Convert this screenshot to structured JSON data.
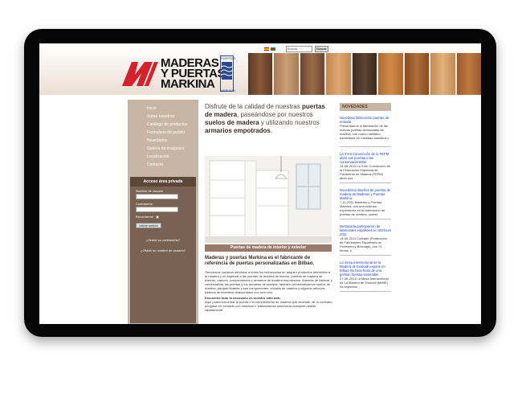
{
  "header": {
    "brand_lines": [
      "Maderas",
      "y puertas",
      "Markina"
    ],
    "puertas_label": "PUERTAS",
    "nervion_label": "NERVION",
    "search_placeholder": "Buscar ...",
    "search_button": "Buscar"
  },
  "nav": {
    "items": [
      "Inicio",
      "Sobre nosotros",
      "Catálogo de productos",
      "Formulario de pedido",
      "Novedades",
      "Galería de imágenes",
      "Localización",
      "Contacto"
    ]
  },
  "access": {
    "title": "Acceso área privada",
    "username_label": "Nombre de usuario",
    "password_label": "Contraseña",
    "remember_label": "Recordarme",
    "login_button": "Iniciar sesión",
    "forgot_password": "¿Olvidó su contraseña?",
    "forgot_username": "¿Olvidó su nombre de usuario?"
  },
  "main": {
    "intro_1": "Disfrute de la calidad de nuestras",
    "intro_b1": "puertas de madera",
    "intro_2": ", paseándose por nuestros",
    "intro_b2": "suelos de madera",
    "intro_3": " y utilizando nuestros",
    "intro_b3": "armarios empotrados",
    "intro_4": ".",
    "photo_caption": "Puertas de madera de interior y exterior",
    "subtitle": "Maderas y puertas Markina es el fabricante de referencia de puertas personalizadas en Bilbao.",
    "body_1": "Ofrecemos nuestros servicios a todos los interesados en adquirir productos referentes a la madera y en especial a las puertas de madera de interior, puertas de madera de exterior, marcos, complementos y armarios de madera empotrados. Además de fabricar y comercializar las puertas y los armarios de madera, también comercializamos suelos de madera, parquet flotante y sus componentes, zócalos de madera y algunos artículos básicos de ferretería relacionados con todo ello.",
    "body_2": "Encuentre todo lo necesario en nuestro sitio web.",
    "body_3": "Aquí podrá encontrar la puerta o el complemento de madera que necesite, de lo contrario, póngase en contacto con nosotros e intentaremos solucionar cualquier pedido rápidamente."
  },
  "news": {
    "title": "NOVEDADES",
    "items": [
      {
        "headline": "Novedosa fabricación puertas de entrada",
        "text": "Presentamos la fabricación de las nuevas puertas acorazadas de madera, con marco metálico, barnizadas en medidas standard o ..."
      },
      {
        "headline": "La XVIII Convención de la FEPM abrió sus puertas a los conservacionistas",
        "text": "14-08-2011 La XVIII Convención de la Federación Española de Pavimento de Madera (FEPM) abrió sus"
      },
      {
        "headline": "Novedosos diseños de puertas de madera de Maderas y Puertas Markina",
        "text": "7-11-2011 Maderas y Puertas Markina, con una extensa experiencia en la fabricación de puertas de madera, suelos"
      },
      {
        "headline": "Destacada participación de fabricantes españoles en Interzum 2011",
        "text": "14-06-2011 Cofearfe (Federación de Fabricantes Españoles de Ferretería y Bricolaje), con 21 firmas, y"
      },
      {
        "headline": "La mesa intersectorial de la Madera de Euskadi expone en Bilbao los beneficios de una gestión forestal sostenible",
        "text": "07-06-2011 La Mesa Intersectorial de La Madera de Euskadi (MIME) ha expuesto"
      }
    ]
  },
  "colors": {
    "sidebar": "#c7b6a4",
    "access_box": "#7a6253",
    "caption_bar": "#9a7a6a",
    "news_link": "#1a3fbf",
    "logo_red": "#d6202a",
    "frame": "#060606"
  }
}
